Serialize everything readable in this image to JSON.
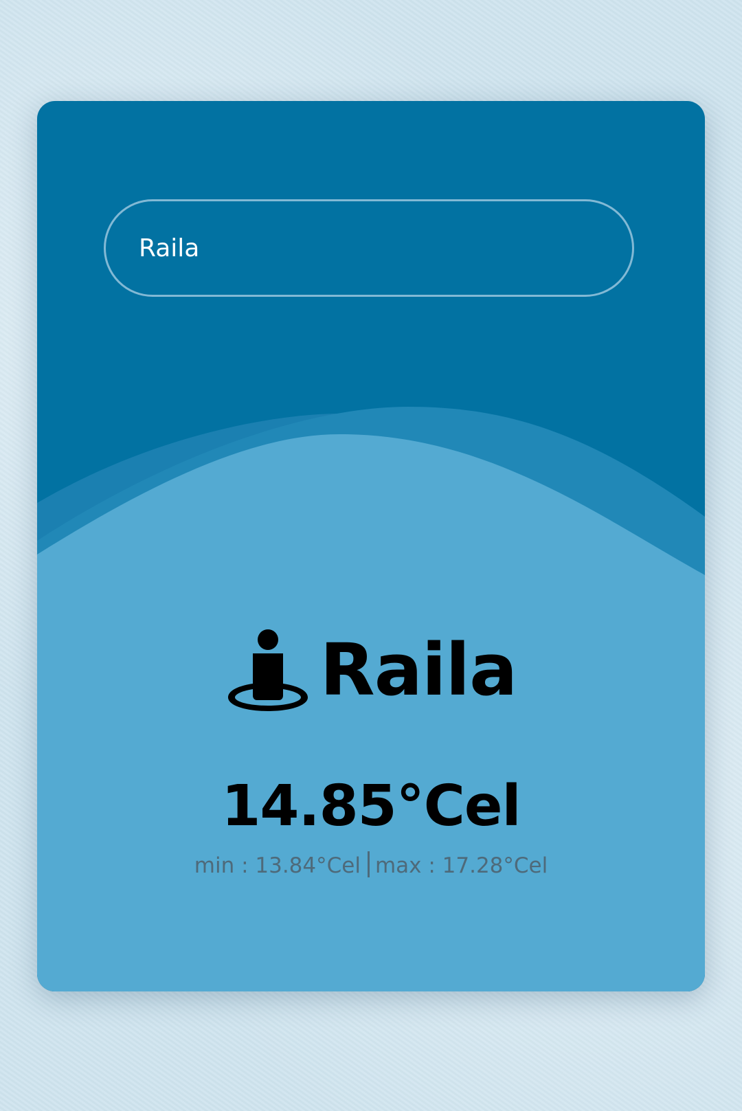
{
  "search": {
    "value": "Raila",
    "placeholder": ""
  },
  "weather": {
    "city": "Raila",
    "location_icon": "person-pin-icon",
    "temperature": "14.85°Cel",
    "min_label": "min : 13.84°Cel",
    "max_label": "max : 17.28°Cel"
  },
  "colors": {
    "card_top": "#0272a2",
    "card_bottom": "#54aad2",
    "wave_middle": "#2188b7",
    "text_muted": "#4e6a7a"
  }
}
